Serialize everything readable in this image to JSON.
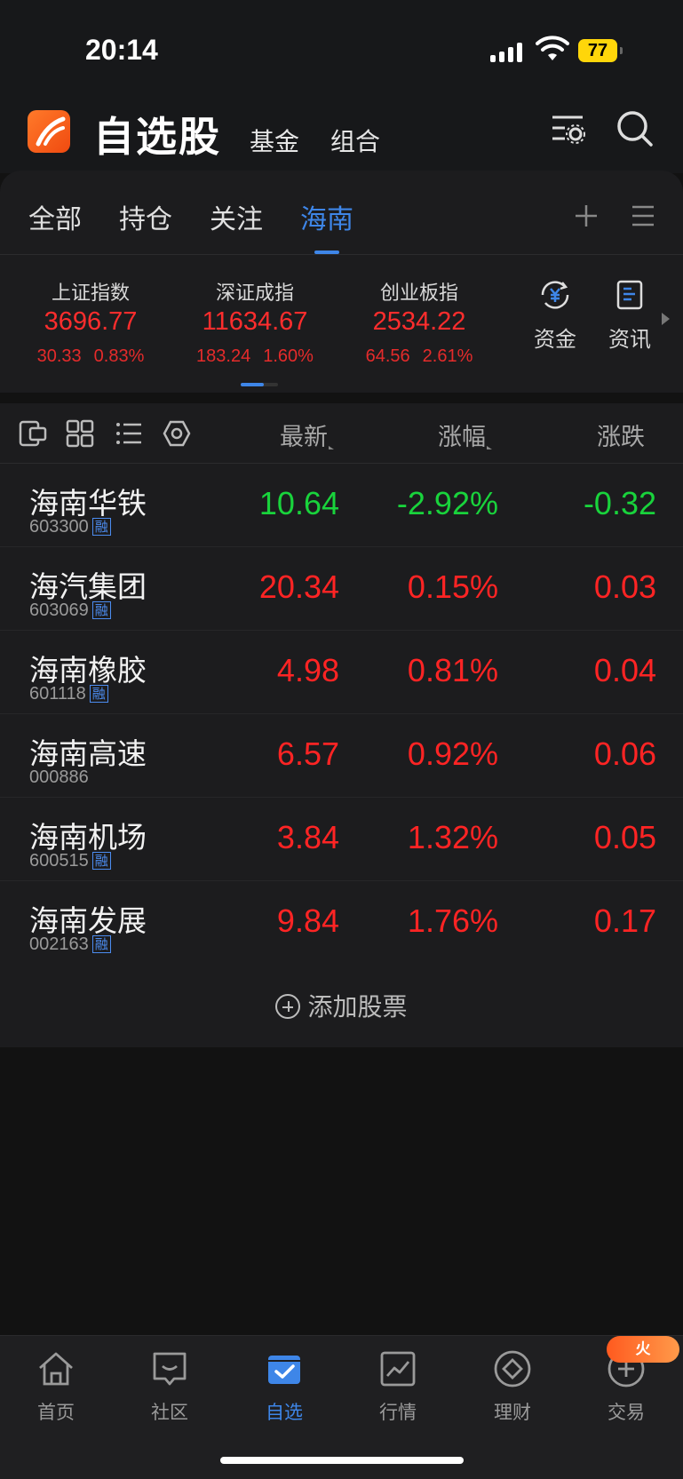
{
  "status_bar": {
    "time": "20:14",
    "battery": "77"
  },
  "header": {
    "title": "自选股",
    "tabs": [
      "基金",
      "组合"
    ]
  },
  "group_tabs": {
    "items": [
      "全部",
      "持仓",
      "关注",
      "海南"
    ],
    "active": "海南"
  },
  "indices": [
    {
      "name": "上证指数",
      "value": "3696.77",
      "change": "30.33",
      "percent": "0.83%"
    },
    {
      "name": "深证成指",
      "value": "11634.67",
      "change": "183.24",
      "percent": "1.60%"
    },
    {
      "name": "创业板指",
      "value": "2534.22",
      "change": "64.56",
      "percent": "2.61%"
    }
  ],
  "quick_links": [
    {
      "label": "资金",
      "icon": "yuan-flow-icon"
    },
    {
      "label": "资讯",
      "icon": "news-doc-icon"
    }
  ],
  "columns": {
    "latest": "最新",
    "change_pct": "涨幅",
    "change": "涨跌"
  },
  "stocks": [
    {
      "name": "海南华铁",
      "code": "603300",
      "margin": "融",
      "price": "10.64",
      "pct": "-2.92%",
      "chg": "-0.32",
      "trend": "down"
    },
    {
      "name": "海汽集团",
      "code": "603069",
      "margin": "融",
      "price": "20.34",
      "pct": "0.15%",
      "chg": "0.03",
      "trend": "up"
    },
    {
      "name": "海南橡胶",
      "code": "601118",
      "margin": "融",
      "price": "4.98",
      "pct": "0.81%",
      "chg": "0.04",
      "trend": "up"
    },
    {
      "name": "海南高速",
      "code": "000886",
      "margin": "",
      "price": "6.57",
      "pct": "0.92%",
      "chg": "0.06",
      "trend": "up"
    },
    {
      "name": "海南机场",
      "code": "600515",
      "margin": "融",
      "price": "3.84",
      "pct": "1.32%",
      "chg": "0.05",
      "trend": "up"
    },
    {
      "name": "海南发展",
      "code": "002163",
      "margin": "融",
      "price": "9.84",
      "pct": "1.76%",
      "chg": "0.17",
      "trend": "up"
    }
  ],
  "add_stock_label": "添加股票",
  "bottom_nav": {
    "items": [
      {
        "label": "首页",
        "icon": "home-icon"
      },
      {
        "label": "社区",
        "icon": "community-icon"
      },
      {
        "label": "自选",
        "icon": "watchlist-icon"
      },
      {
        "label": "行情",
        "icon": "market-chart-icon"
      },
      {
        "label": "理财",
        "icon": "wealth-diamond-icon"
      },
      {
        "label": "交易",
        "icon": "trade-plus-icon"
      }
    ],
    "active": "自选",
    "hot_badge": "火"
  },
  "colors": {
    "up": "#ff2424",
    "down": "#19d33c",
    "accent": "#3e86e8"
  }
}
